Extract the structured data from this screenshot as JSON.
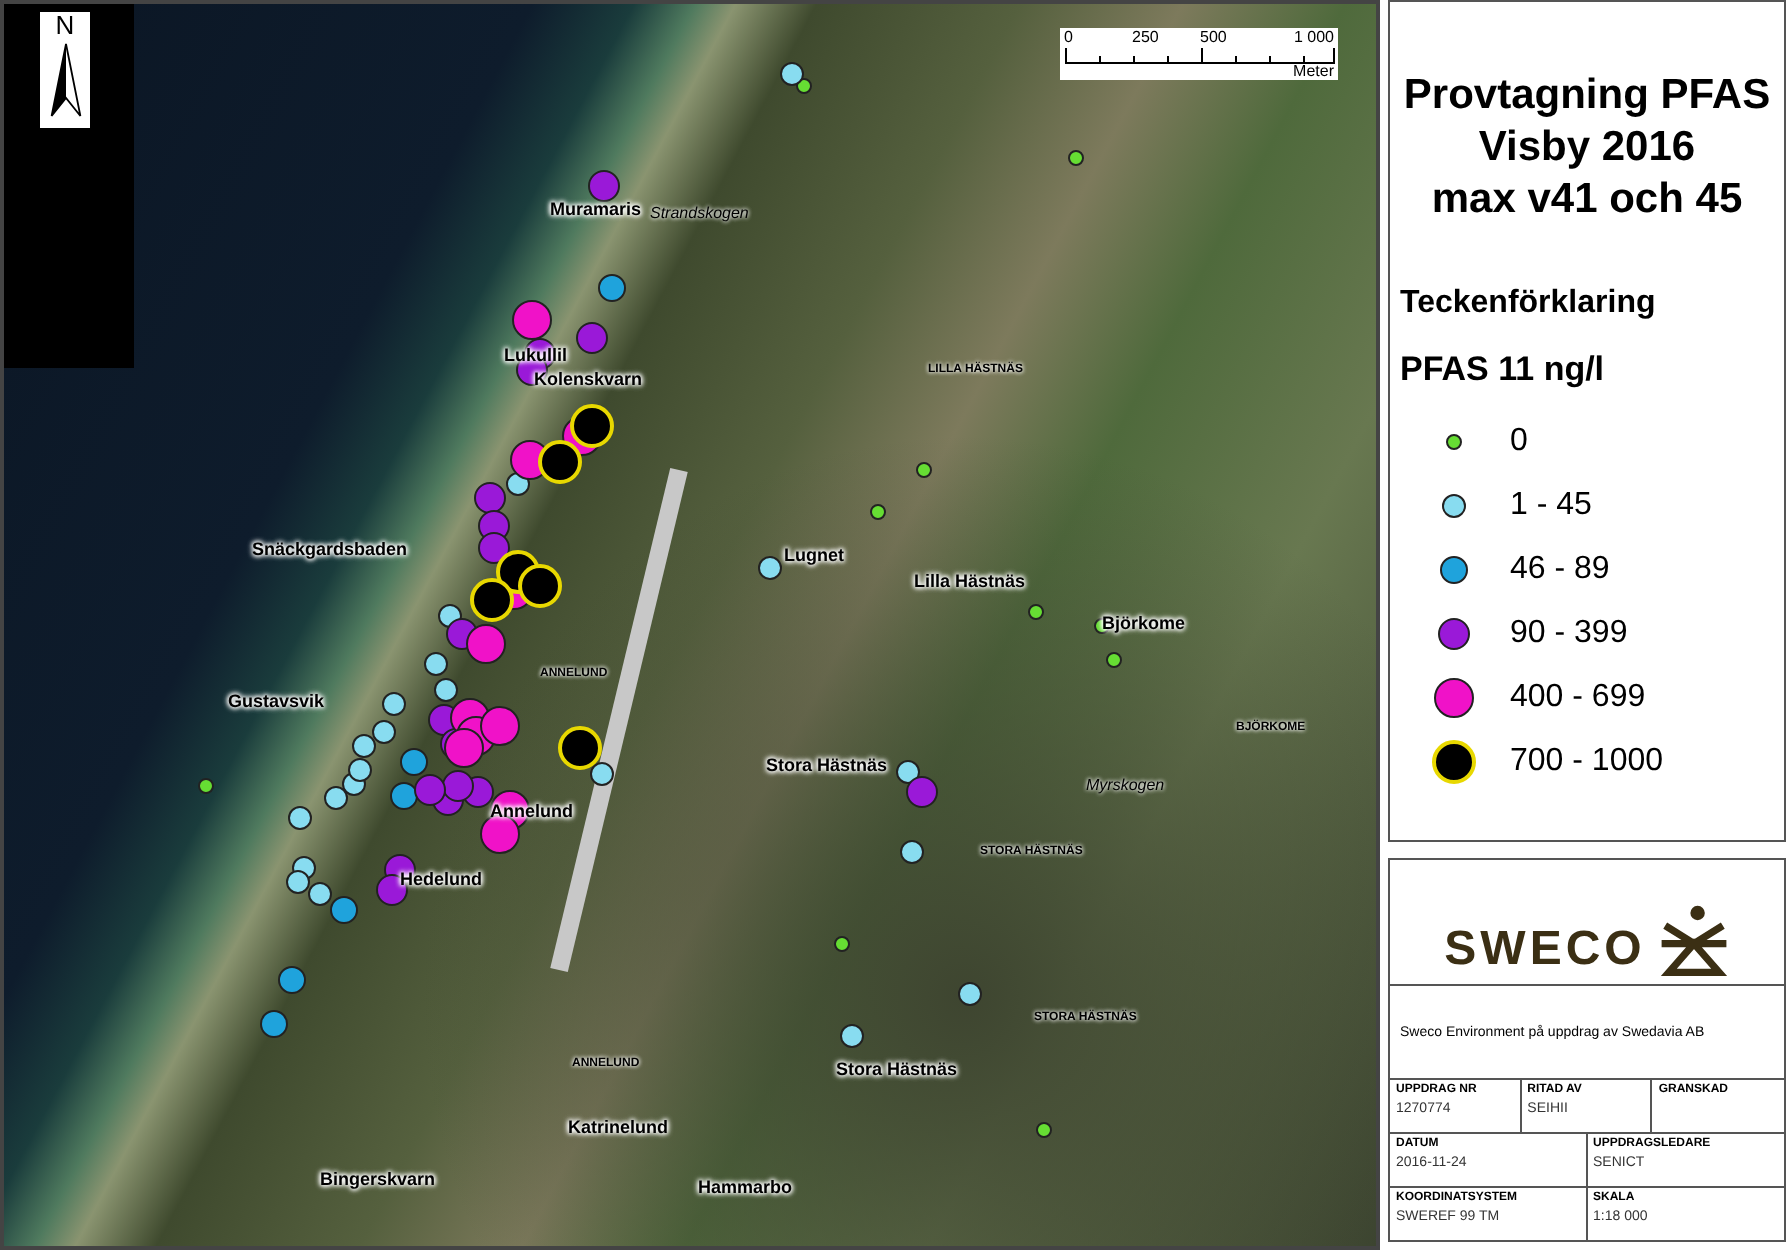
{
  "map": {
    "north_label": "N",
    "scale_bar": {
      "ticks": [
        "0",
        "250",
        "500",
        "1 000"
      ],
      "unit": "Meter"
    },
    "labels": [
      {
        "text": "Muramaris",
        "kind": "town"
      },
      {
        "text": "Strandskogen",
        "kind": "locality"
      },
      {
        "text": "Lukullil",
        "kind": "town"
      },
      {
        "text": "Kolenskvarn",
        "kind": "town"
      },
      {
        "text": "Snäckgardsbaden",
        "kind": "town"
      },
      {
        "text": "Gustavsvik",
        "kind": "town"
      },
      {
        "text": "ANNELUND",
        "kind": "area"
      },
      {
        "text": "Annelund",
        "kind": "town"
      },
      {
        "text": "Hedelund",
        "kind": "town"
      },
      {
        "text": "ANNELUND",
        "kind": "area"
      },
      {
        "text": "Katrinelund",
        "kind": "town"
      },
      {
        "text": "Bingerskvarn",
        "kind": "town"
      },
      {
        "text": "Hammarbo",
        "kind": "town"
      },
      {
        "text": "LILLA HÄSTNÄS",
        "kind": "area"
      },
      {
        "text": "Lugnet",
        "kind": "town"
      },
      {
        "text": "Lilla Hästnäs",
        "kind": "town"
      },
      {
        "text": "Björkome",
        "kind": "town"
      },
      {
        "text": "BJÖRKOME",
        "kind": "area"
      },
      {
        "text": "Stora Hästnäs",
        "kind": "town"
      },
      {
        "text": "Myrskogen",
        "kind": "locality"
      },
      {
        "text": "STORA HÄSTNÄS",
        "kind": "area"
      },
      {
        "text": "STORA HÄSTNÄS",
        "kind": "area"
      },
      {
        "text": "Stora Hästnäs",
        "kind": "town"
      }
    ],
    "samples": [
      {
        "color": "#66dd33"
      },
      {
        "color": "#66dd33"
      },
      {
        "color": "#66dd33"
      },
      {
        "color": "#66dd33"
      },
      {
        "color": "#66dd33"
      },
      {
        "color": "#66dd33"
      },
      {
        "color": "#66dd33"
      },
      {
        "color": "#66dd33"
      },
      {
        "color": "#66dd33"
      },
      {
        "color": "#66dd33"
      },
      {
        "color": "#88dcf0"
      },
      {
        "color": "#88dcf0"
      },
      {
        "color": "#88dcf0"
      },
      {
        "color": "#88dcf0"
      },
      {
        "color": "#88dcf0"
      },
      {
        "color": "#88dcf0"
      },
      {
        "color": "#88dcf0"
      },
      {
        "color": "#88dcf0"
      },
      {
        "color": "#88dcf0"
      },
      {
        "color": "#88dcf0"
      },
      {
        "color": "#88dcf0"
      },
      {
        "color": "#88dcf0"
      },
      {
        "color": "#88dcf0"
      },
      {
        "color": "#88dcf0"
      },
      {
        "color": "#88dcf0"
      },
      {
        "color": "#88dcf0"
      },
      {
        "color": "#88dcf0"
      },
      {
        "color": "#88dcf0"
      },
      {
        "color": "#88dcf0"
      },
      {
        "color": "#88dcf0"
      },
      {
        "color": "#88dcf0"
      },
      {
        "color": "#1fa3dc"
      },
      {
        "color": "#1fa3dc"
      },
      {
        "color": "#1fa3dc"
      },
      {
        "color": "#1fa3dc"
      },
      {
        "color": "#1fa3dc"
      },
      {
        "color": "#1fa3dc"
      },
      {
        "color": "#9a19d8"
      },
      {
        "color": "#9a19d8"
      },
      {
        "color": "#9a19d8"
      },
      {
        "color": "#9a19d8"
      },
      {
        "color": "#9a19d8"
      },
      {
        "color": "#9a19d8"
      },
      {
        "color": "#9a19d8"
      },
      {
        "color": "#9a19d8"
      },
      {
        "color": "#9a19d8"
      },
      {
        "color": "#9a19d8"
      },
      {
        "color": "#9a19d8"
      },
      {
        "color": "#9a19d8"
      },
      {
        "color": "#9a19d8"
      },
      {
        "color": "#9a19d8"
      },
      {
        "color": "#9a19d8"
      },
      {
        "color": "#9a19d8"
      },
      {
        "color": "#9a19d8"
      },
      {
        "color": "#f012c8"
      },
      {
        "color": "#f012c8"
      },
      {
        "color": "#f012c8"
      },
      {
        "color": "#f012c8"
      },
      {
        "color": "#f012c8"
      },
      {
        "color": "#f012c8"
      },
      {
        "color": "#f012c8"
      },
      {
        "color": "#f012c8"
      },
      {
        "color": "#f012c8"
      },
      {
        "color": "#f012c8"
      },
      {
        "color": "#f012c8"
      },
      {
        "color": "#000000"
      },
      {
        "color": "#000000"
      },
      {
        "color": "#000000"
      },
      {
        "color": "#000000"
      },
      {
        "color": "#000000"
      },
      {
        "color": "#000000"
      }
    ]
  },
  "legend": {
    "title": [
      "Provtagning PFAS",
      "Visby 2016",
      "max v41 och 45"
    ],
    "heading": "Teckenförklaring",
    "subheading": "PFAS 11 ng/l",
    "items": [
      {
        "label": "0",
        "color": "#66dd33"
      },
      {
        "label": "1 - 45",
        "color": "#88dcf0"
      },
      {
        "label": "46 - 89",
        "color": "#1fa3dc"
      },
      {
        "label": "90 - 399",
        "color": "#9a19d8"
      },
      {
        "label": "400 - 699",
        "color": "#f012c8"
      },
      {
        "label": "700 - 1000",
        "color": "#000000"
      }
    ]
  },
  "title_block": {
    "logo": "SWECO",
    "description": "Sweco Environment på uppdrag av Swedavia AB",
    "fields": [
      {
        "label": "UPPDRAG NR",
        "value": "1270774"
      },
      {
        "label": "RITAD AV",
        "value": "SEIHII"
      },
      {
        "label": "GRANSKAD"
      },
      {
        "label": "DATUM",
        "value": "2016-11-24"
      },
      {
        "label": "UPPDRAGSLEDARE",
        "value": "SENICT"
      },
      {
        "label": "KOORDINATSYSTEM",
        "value": "SWEREF 99 TM"
      },
      {
        "label": "SKALA",
        "value": "1:18 000"
      }
    ]
  }
}
